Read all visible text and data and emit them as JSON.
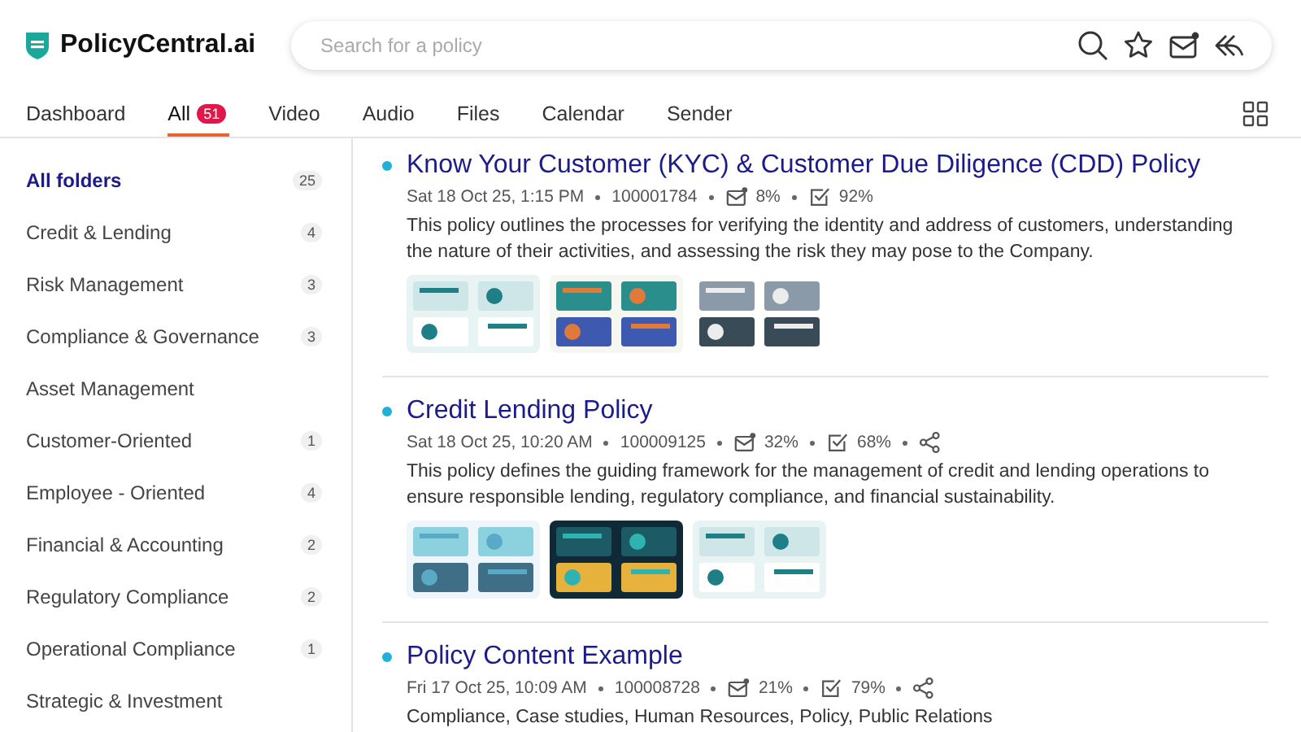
{
  "brand": "PolicyCentral.ai",
  "search": {
    "placeholder": "Search for a policy"
  },
  "tabs": [
    {
      "label": "Dashboard",
      "selected": false
    },
    {
      "label": "All",
      "badge": "51",
      "selected": true
    },
    {
      "label": "Video",
      "selected": false
    },
    {
      "label": "Audio",
      "selected": false
    },
    {
      "label": "Files",
      "selected": false
    },
    {
      "label": "Calendar",
      "selected": false
    },
    {
      "label": "Sender",
      "selected": false
    }
  ],
  "folders": [
    {
      "label": "All folders",
      "count": "25",
      "selected": true
    },
    {
      "label": "Credit & Lending",
      "count": "4",
      "selected": false
    },
    {
      "label": "Risk Management",
      "count": "3",
      "selected": false
    },
    {
      "label": "Compliance & Governance",
      "count": "3",
      "selected": false
    },
    {
      "label": "Asset Management",
      "selected": false
    },
    {
      "label": "Customer-Oriented",
      "count": "1",
      "selected": false
    },
    {
      "label": "Employee - Oriented",
      "count": "4",
      "selected": false
    },
    {
      "label": "Financial & Accounting",
      "count": "2",
      "selected": false
    },
    {
      "label": "Regulatory Compliance",
      "count": "2",
      "selected": false
    },
    {
      "label": "Operational Compliance",
      "count": "1",
      "selected": false
    },
    {
      "label": "Strategic & Investment",
      "selected": false
    }
  ],
  "policies": [
    {
      "title": "Know Your Customer (KYC) & Customer Due Diligence (CDD) Policy",
      "date": "Sat 18 Oct 25, 1:15 PM",
      "id": "100001784",
      "sent": "8%",
      "done": "92%",
      "shareable": false,
      "description": "This policy outlines the processes for verifying the identity and address of customers, understanding the nature of their activities, and assessing the risk they may pose to the Company."
    },
    {
      "title": "Credit Lending Policy",
      "date": "Sat 18 Oct 25, 10:20 AM",
      "id": "100009125",
      "sent": "32%",
      "done": "68%",
      "shareable": true,
      "description": "This policy defines the guiding framework for the management of credit and lending operations to ensure responsible lending, regulatory compliance, and financial sustainability."
    },
    {
      "title": "Policy Content Example",
      "date": "Fri 17 Oct 25, 10:09 AM",
      "id": "100008728",
      "sent": "21%",
      "done": "79%",
      "shareable": true,
      "tags": "Compliance, Case studies, Human Resources, Policy, Public Relations"
    }
  ]
}
